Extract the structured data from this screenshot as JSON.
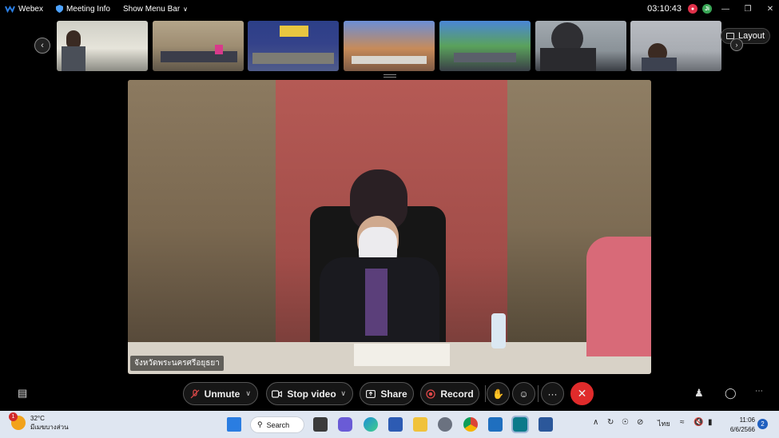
{
  "titlebar": {
    "app_name": "Webex",
    "meeting_info": "Meeting Info",
    "show_menu_bar": "Show Menu Bar",
    "clock": "03:10:43",
    "avatar_initial": "Ji"
  },
  "filmstrip": {
    "layout_label": "Layout",
    "thumb_count": 7
  },
  "stage": {
    "speaker_name": "จังหวัดพระนครศรีอยุธยา"
  },
  "controls": {
    "unmute": "Unmute",
    "stop_video": "Stop video",
    "share": "Share",
    "record": "Record",
    "more": "···"
  },
  "taskbar": {
    "temperature": "32°C",
    "weather_text": "มีเมฆบางส่วน",
    "weather_badge": "1",
    "search": "Search",
    "language": "ไทย",
    "time": "11:06",
    "date": "6/6/2566",
    "notifications": "2"
  },
  "colors": {
    "end_call": "#e02b2b",
    "taskbar_bg": "#dfe6f1",
    "webex_blue": "#2a7de1"
  }
}
